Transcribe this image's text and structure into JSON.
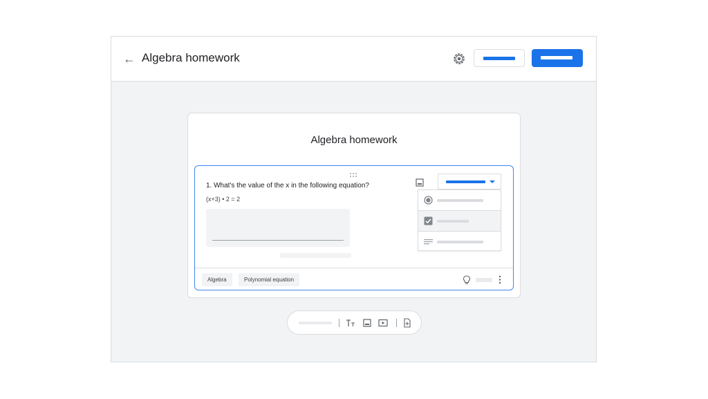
{
  "header": {
    "title": "Algebra homework",
    "back_icon": "arrow-back-icon",
    "settings_icon": "gear-icon",
    "accent_color": "#1a73e8"
  },
  "form": {
    "title": "Algebra homework",
    "question": {
      "number_and_text": "1. What's the value of the x in the following equation?",
      "equation": "(x+3) • 2 = 2",
      "type_menu": [
        {
          "icon": "radio-button-icon",
          "selected": true
        },
        {
          "icon": "checkbox-icon",
          "selected": true
        },
        {
          "icon": "short-text-icon",
          "selected": false
        }
      ],
      "tags": [
        "Algebra",
        "Polynomial equation"
      ]
    }
  },
  "toolbar": {
    "icons": [
      "text-format-icon",
      "image-icon",
      "video-icon",
      "import-question-icon"
    ]
  }
}
